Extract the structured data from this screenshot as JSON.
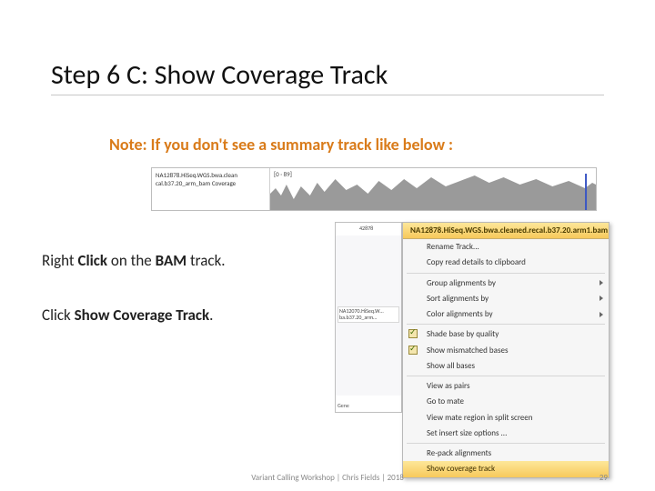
{
  "title": "Step 6 C: Show Coverage Track",
  "note": "Note: If you don't see a summary track like below :",
  "instruction1_pre": "Right ",
  "instruction1_bold": "Click",
  "instruction1_mid": " on the ",
  "instruction1_bold2": "BAM",
  "instruction1_post": " track.",
  "instruction2_pre": "Click ",
  "instruction2_bold": "Show Coverage Track",
  "instruction2_post": ".",
  "coverage": {
    "line1": "NA12878.HiSeq.WGS.bwa.clean",
    "line2": "cal.b37.20_arm_bam Coverage",
    "range": "[0 · 89]"
  },
  "igv": {
    "coord": "42878",
    "track_line1": "NA12070.HiSeq.W…",
    "track_line2": "ba.b37.20_arm…",
    "bottom": "Gene"
  },
  "menu": {
    "title_bam": "NA12878.HiSeq.WGS.bwa.cleaned.recal.b37.20.arm1.bam",
    "items": [
      {
        "label": "Rename Track...",
        "interactable": true
      },
      {
        "label": "Copy read details to clipboard",
        "interactable": true
      }
    ],
    "group": "Group alignments by",
    "sort": "Sort alignments by",
    "color": "Color alignments by",
    "shade": "Shade base by quality",
    "mismatch": "Show mismatched bases",
    "allbases": "Show all bases",
    "pairs": "View as pairs",
    "goto": "Go to mate",
    "split": "View mate region in split screen",
    "insert": "Set insert size options ...",
    "repack": "Re-pack alignments",
    "showcov": "Show coverage track"
  },
  "footer": {
    "text": "Variant Calling Workshop | Chris Fields | 2018",
    "page": "29"
  }
}
